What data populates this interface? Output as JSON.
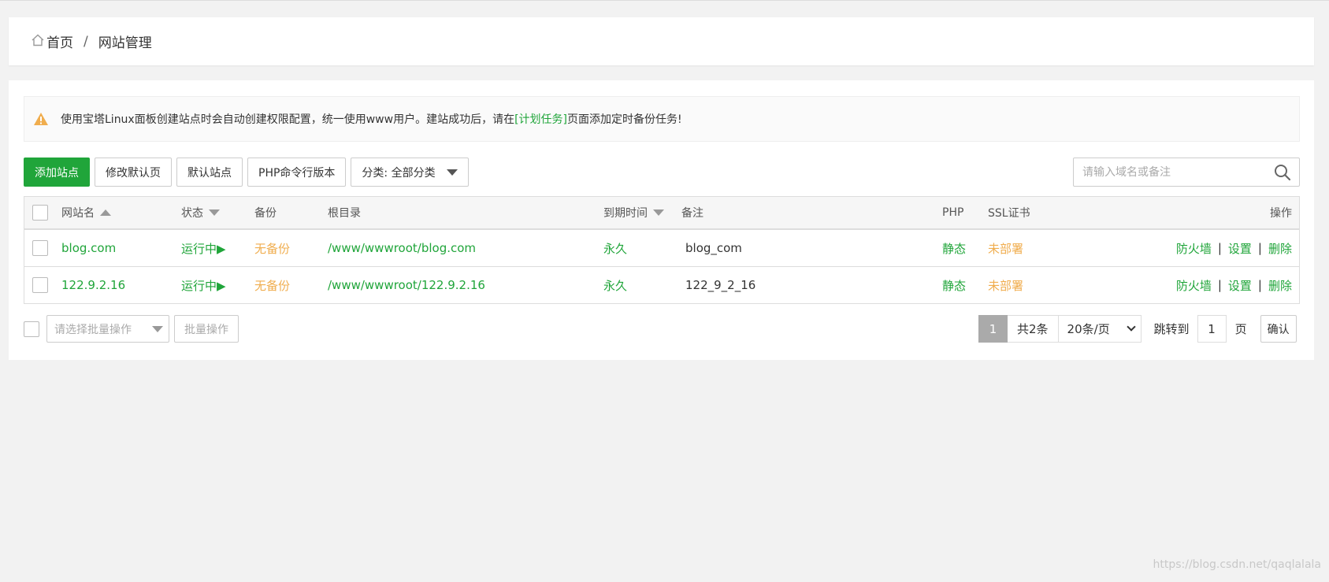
{
  "breadcrumb": {
    "home": "首页",
    "separator": "/",
    "current": "网站管理"
  },
  "notice": {
    "text_before": "使用宝塔Linux面板创建站点时会自动创建权限配置，统一使用www用户。建站成功后，请在",
    "link": "[计划任务]",
    "text_after": "页面添加定时备份任务!"
  },
  "toolbar": {
    "add_site": "添加站点",
    "edit_default_page": "修改默认页",
    "default_site": "默认站点",
    "php_cli_version": "PHP命令行版本",
    "category": "分类: 全部分类"
  },
  "search": {
    "placeholder": "请输入域名或备注"
  },
  "table": {
    "columns": {
      "name": "网站名",
      "status": "状态",
      "backup": "备份",
      "root": "根目录",
      "expire": "到期时间",
      "remark": "备注",
      "php": "PHP",
      "ssl": "SSL证书",
      "ops": "操作"
    },
    "rows": [
      {
        "name": "blog.com",
        "status": "运行中▶",
        "backup": "无备份",
        "root": "/www/wwwroot/blog.com",
        "expire": "永久",
        "remark": "blog_com",
        "php": "静态",
        "ssl": "未部署",
        "op_firewall": "防火墙",
        "op_settings": "设置",
        "op_delete": "删除"
      },
      {
        "name": "122.9.2.16",
        "status": "运行中▶",
        "backup": "无备份",
        "root": "/www/wwwroot/122.9.2.16",
        "expire": "永久",
        "remark": "122_9_2_16",
        "php": "静态",
        "ssl": "未部署",
        "op_firewall": "防火墙",
        "op_settings": "设置",
        "op_delete": "删除"
      }
    ],
    "op_separator": "|"
  },
  "batch": {
    "placeholder": "请选择批量操作",
    "button": "批量操作"
  },
  "pager": {
    "current_page": "1",
    "total": "共2条",
    "per_page": "20条/页",
    "jump_label": "跳转到",
    "jump_value": "1",
    "page_unit": "页",
    "confirm": "确认"
  },
  "watermark": "https://blog.csdn.net/qaqlalala",
  "colors": {
    "accent": "#20a53a",
    "warning": "#f0ad4e",
    "background": "#f2f2f2"
  }
}
